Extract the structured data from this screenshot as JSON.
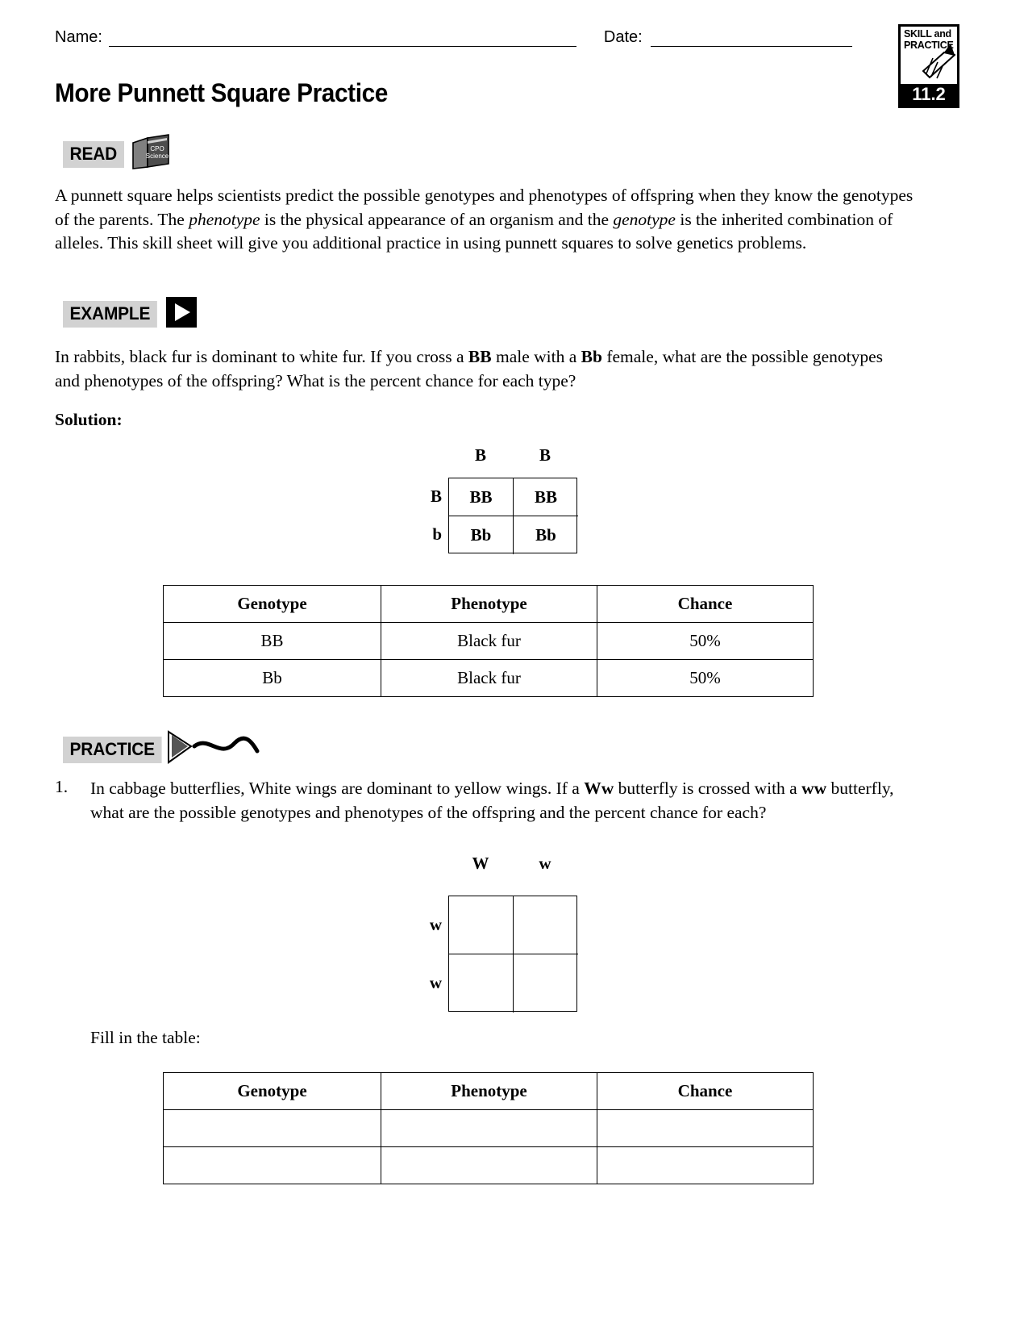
{
  "header": {
    "name_label": "Name:",
    "date_label": "Date:",
    "name_value": "",
    "date_value": ""
  },
  "badge": {
    "line1": "SKILL and",
    "line2": "PRACTICE",
    "number": "11.2",
    "icon": "pencil-icon",
    "colors": {
      "fill": "#000000",
      "text": "#ffffff"
    }
  },
  "title": "More Punnett Square Practice",
  "sections": {
    "read": {
      "label": "READ",
      "icon": "cpo-science-book-icon",
      "book_line1": "CPO",
      "book_line2": "Science",
      "chip_color": "#d2d2d2",
      "paragraph_plain": "A punnett square helps scientists predict the possible genotypes and phenotypes of offspring when they know the genotypes of the parents. The phenotype is the physical appearance of an organism and the genotype is the inherited combination of alleles. This skill sheet will give you additional practice in using punnett squares to solve genetics problems.",
      "paragraph_parts": [
        {
          "text": "A punnett square helps scientists predict the possible genotypes and phenotypes of offspring when they know the genotypes of the parents. The ",
          "style": "normal"
        },
        {
          "text": "phenotype",
          "style": "italic"
        },
        {
          "text": " is the physical appearance of an organism and the ",
          "style": "normal"
        },
        {
          "text": "genotype",
          "style": "italic"
        },
        {
          "text": " is the inherited combination of alleles. This skill sheet will give you additional practice in using punnett squares to solve genetics problems.",
          "style": "normal"
        }
      ]
    },
    "example": {
      "label": "EXAMPLE",
      "icon": "play-triangle-icon",
      "question_plain": "In rabbits, black fur is dominant to white fur. If you cross a BB male with a Bb female, what are the possible genotypes and phenotypes of the offspring? What is the percent chance for each type?",
      "question_parts": [
        {
          "text": "In rabbits, black fur is dominant to white fur. If you cross a ",
          "style": "normal"
        },
        {
          "text": "BB",
          "style": "bold"
        },
        {
          "text": " male with a ",
          "style": "normal"
        },
        {
          "text": "Bb",
          "style": "bold"
        },
        {
          "text": " female, what are the possible genotypes and phenotypes of the offspring? What is the percent chance for each type?",
          "style": "normal"
        }
      ],
      "solution_label": "Solution:",
      "punnett": {
        "top_labels": [
          "B",
          "B"
        ],
        "left_labels": [
          "B",
          "b"
        ],
        "cells": [
          [
            "BB",
            "BB"
          ],
          [
            "Bb",
            "Bb"
          ]
        ]
      },
      "table": {
        "headers": [
          "Genotype",
          "Phenotype",
          "Chance"
        ],
        "rows": [
          [
            "BB",
            "Black fur",
            "50%"
          ],
          [
            "Bb",
            "Black fur",
            "50%"
          ]
        ]
      }
    },
    "practice": {
      "label": "PRACTICE",
      "icon": "triangle-squiggle-icon",
      "items": [
        {
          "number": "1.",
          "question_plain": "In cabbage butterflies, White wings are dominant to yellow wings. If a Ww butterfly is crossed with a ww butterfly, what are the possible genotypes and phenotypes of the offspring and the percent chance for each?",
          "question_parts": [
            {
              "text": "In cabbage butterflies, White wings are dominant to yellow wings. If a ",
              "style": "normal"
            },
            {
              "text": "Ww",
              "style": "bold"
            },
            {
              "text": " butterfly is crossed with a ",
              "style": "normal"
            },
            {
              "text": "ww",
              "style": "bold"
            },
            {
              "text": " butterfly, what are the possible genotypes and phenotypes of the offspring and the percent chance for each?",
              "style": "normal"
            }
          ],
          "punnett": {
            "top_labels": [
              "W",
              "w"
            ],
            "left_labels": [
              "w",
              "w"
            ],
            "cells": [
              [
                "",
                ""
              ],
              [
                "",
                ""
              ]
            ]
          },
          "fill_label": "Fill in the table:",
          "table": {
            "headers": [
              "Genotype",
              "Phenotype",
              "Chance"
            ],
            "rows": [
              [
                "",
                "",
                ""
              ],
              [
                "",
                "",
                ""
              ]
            ]
          }
        }
      ]
    }
  }
}
